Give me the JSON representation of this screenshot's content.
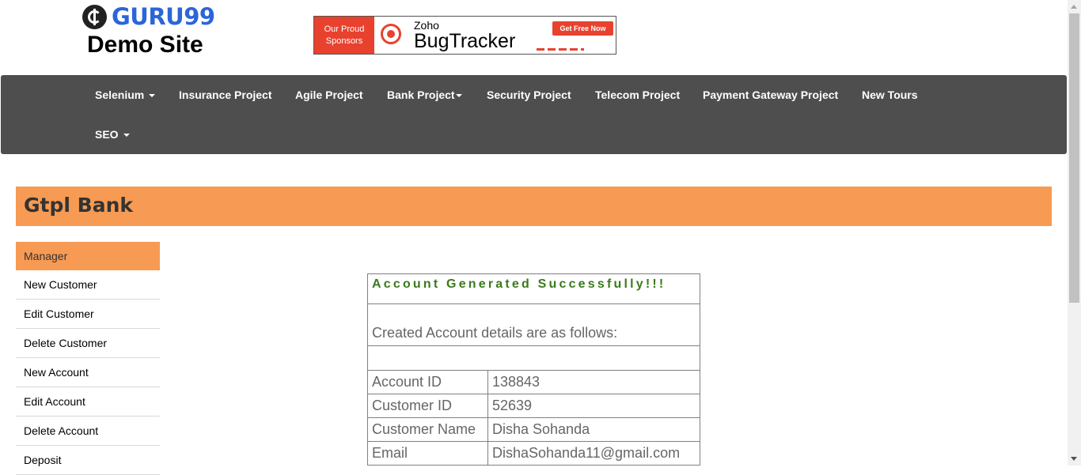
{
  "brand": {
    "logo_text": "GURU99",
    "subtitle": "Demo Site"
  },
  "banner": {
    "left_line1": "Our Proud",
    "left_line2": "Sponsors",
    "zoho": "Zoho",
    "product": "BugTracker",
    "cta": "Get Free Now"
  },
  "nav": {
    "items": [
      {
        "label": "Selenium",
        "dropdown": true
      },
      {
        "label": "Insurance Project",
        "dropdown": false
      },
      {
        "label": "Agile Project",
        "dropdown": false
      },
      {
        "label": "Bank Project",
        "dropdown": true
      },
      {
        "label": "Security Project",
        "dropdown": false
      },
      {
        "label": "Telecom Project",
        "dropdown": false
      },
      {
        "label": "Payment Gateway Project",
        "dropdown": false
      },
      {
        "label": "New Tours",
        "dropdown": false
      },
      {
        "label": "SEO",
        "dropdown": true
      }
    ]
  },
  "bank": {
    "title": "Gtpl Bank"
  },
  "sidebar": {
    "items": [
      {
        "label": "Manager",
        "active": true
      },
      {
        "label": "New Customer"
      },
      {
        "label": "Edit Customer"
      },
      {
        "label": "Delete Customer"
      },
      {
        "label": "New Account"
      },
      {
        "label": "Edit Account"
      },
      {
        "label": "Delete Account"
      },
      {
        "label": "Deposit"
      }
    ]
  },
  "account": {
    "success_message": "Account Generated Successfully!!!",
    "details_heading": "Created Account details are as follows:",
    "rows": [
      {
        "label": "Account ID",
        "value": "138843"
      },
      {
        "label": "Customer ID",
        "value": "52639"
      },
      {
        "label": "Customer Name",
        "value": "Disha Sohanda"
      },
      {
        "label": "Email",
        "value": "DishaSohanda11@gmail.com"
      }
    ]
  },
  "colors": {
    "accent_orange": "#f79a53",
    "nav_bg": "#4e4e4e",
    "logo_blue": "#2b65d9",
    "success_green": "#3a7a1a"
  }
}
